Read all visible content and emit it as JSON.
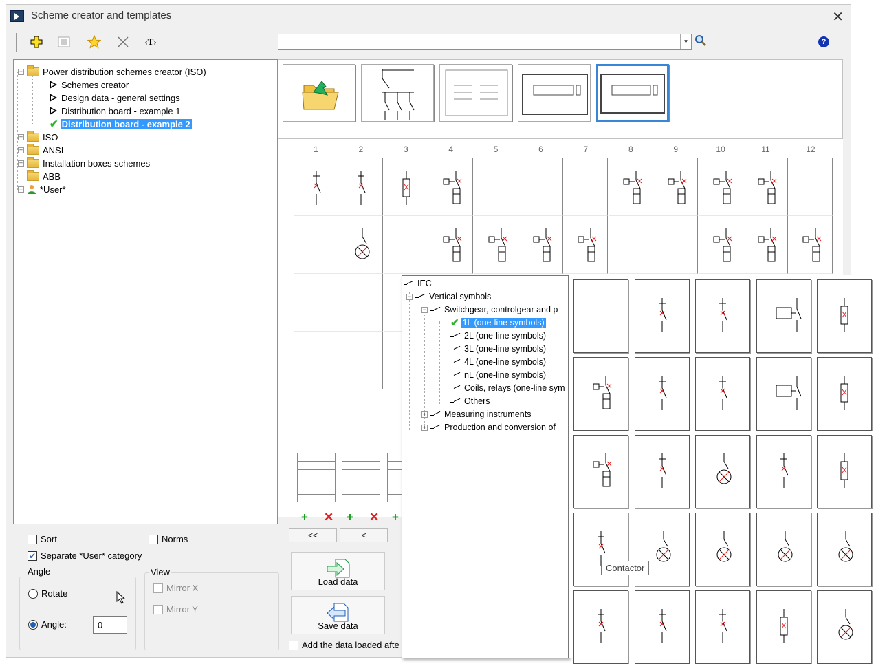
{
  "window": {
    "title": "Scheme creator and templates",
    "close_glyph": "✕"
  },
  "toolbar": {
    "icons": [
      "add-icon",
      "properties-icon",
      "favorite-star-icon",
      "delete-icon",
      "text-tag-icon"
    ],
    "text_tag_label": "‹T›"
  },
  "search": {
    "value": "",
    "dropdown_glyph": "▾"
  },
  "help_glyph": "?",
  "tree": {
    "root": "Power distribution schemes creator (ISO)",
    "children": [
      "Schemes creator",
      "Design data - general settings",
      "Distribution board - example 1",
      "Distribution board - example 2"
    ],
    "selected": "Distribution board - example 2",
    "top_level": [
      "ISO",
      "ANSI",
      "Installation boxes schemes",
      "ABB",
      "*User*"
    ]
  },
  "options": {
    "sort": "Sort",
    "norms": "Norms",
    "separate_user": "Separate *User* category",
    "angle_group": "Angle",
    "rotate": "Rotate",
    "angle": "Angle:",
    "angle_value": "0",
    "view_group": "View",
    "mirror_x": "Mirror X",
    "mirror_y": "Mirror Y"
  },
  "columns": [
    "1",
    "2",
    "3",
    "4",
    "5",
    "6",
    "7",
    "8",
    "9",
    "10",
    "11",
    "12"
  ],
  "nav": {
    "first": "<<",
    "prev": "<"
  },
  "buttons": {
    "load": "Load data",
    "save": "Save data",
    "add_loaded": "Add the data loaded afte"
  },
  "popup_tree": {
    "iec": "IEC",
    "vertical": "Vertical symbols",
    "switchgear": "Switchgear, controlgear and p",
    "items": [
      "1L (one-line symbols)",
      "2L (one-line symbols)",
      "3L (one-line symbols)",
      "4L (one-line symbols)",
      "nL (one-line symbols)",
      "Coils, relays (one-line sym",
      "Others"
    ],
    "selected": "1L (one-line symbols)",
    "measuring": "Measuring instruments",
    "production": "Production and conversion of"
  },
  "tooltip": "Contactor",
  "colors": {
    "selection": "#3399ff",
    "accent_red": "#e02020",
    "add_green": "#1a9a1a"
  }
}
